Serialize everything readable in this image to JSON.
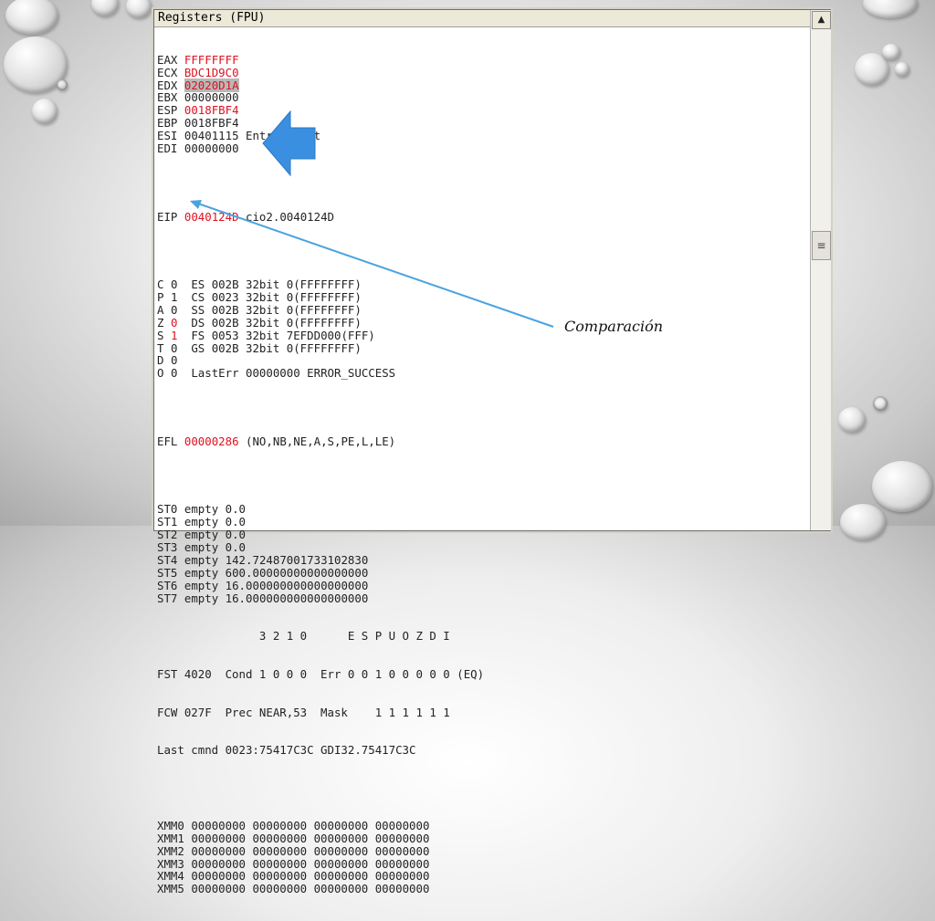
{
  "window": {
    "title": "Registers (FPU)"
  },
  "registers": [
    {
      "name": "EAX",
      "value": "FFFFFFFF",
      "style": "red",
      "comment": ""
    },
    {
      "name": "ECX",
      "value": "BDC1D9C0",
      "style": "red",
      "comment": ""
    },
    {
      "name": "EDX",
      "value": "02020D1A",
      "style": "hl",
      "comment": ""
    },
    {
      "name": "EBX",
      "value": "00000000",
      "style": "",
      "comment": ""
    },
    {
      "name": "ESP",
      "value": "0018FBF4",
      "style": "red",
      "comment": ""
    },
    {
      "name": "EBP",
      "value": "0018FBF4",
      "style": "",
      "comment": ""
    },
    {
      "name": "ESI",
      "value": "00401115",
      "style": "",
      "comment": "Entry point"
    },
    {
      "name": "EDI",
      "value": "00000000",
      "style": "",
      "comment": ""
    }
  ],
  "eip": {
    "name": "EIP",
    "value": "0040124D",
    "comment": "cio2.0040124D"
  },
  "flags": [
    {
      "name": "C",
      "value": "0",
      "red": false,
      "seg": "ES 002B 32bit 0(FFFFFFFF)"
    },
    {
      "name": "P",
      "value": "1",
      "red": false,
      "seg": "CS 0023 32bit 0(FFFFFFFF)"
    },
    {
      "name": "A",
      "value": "0",
      "red": false,
      "seg": "SS 002B 32bit 0(FFFFFFFF)"
    },
    {
      "name": "Z",
      "value": "0",
      "red": true,
      "seg": "DS 002B 32bit 0(FFFFFFFF)"
    },
    {
      "name": "S",
      "value": "1",
      "red": true,
      "seg": "FS 0053 32bit 7EFDD000(FFF)"
    },
    {
      "name": "T",
      "value": "0",
      "red": false,
      "seg": "GS 002B 32bit 0(FFFFFFFF)"
    },
    {
      "name": "D",
      "value": "0",
      "red": false,
      "seg": ""
    },
    {
      "name": "O",
      "value": "0",
      "red": false,
      "seg": "LastErr 00000000 ERROR_SUCCESS"
    }
  ],
  "efl": {
    "name": "EFL",
    "value": "00000286",
    "comment": "(NO,NB,NE,A,S,PE,L,LE)"
  },
  "fpu_stack": [
    {
      "name": "ST0",
      "status": "empty",
      "value": "0.0"
    },
    {
      "name": "ST1",
      "status": "empty",
      "value": "0.0"
    },
    {
      "name": "ST2",
      "status": "empty",
      "value": "0.0"
    },
    {
      "name": "ST3",
      "status": "empty",
      "value": "0.0"
    },
    {
      "name": "ST4",
      "status": "empty",
      "value": "142.72487001733102830"
    },
    {
      "name": "ST5",
      "status": "empty",
      "value": "600.00000000000000000"
    },
    {
      "name": "ST6",
      "status": "empty",
      "value": "16.000000000000000000"
    },
    {
      "name": "ST7",
      "status": "empty",
      "value": "16.000000000000000000"
    }
  ],
  "fpu_bits_header": "               3 2 1 0      E S P U O Z D I",
  "fst": "FST 4020  Cond 1 0 0 0  Err 0 0 1 0 0 0 0 0 (EQ)",
  "fcw": "FCW 027F  Prec NEAR,53  Mask    1 1 1 1 1 1",
  "last_cmnd": "Last cmnd 0023:75417C3C GDI32.75417C3C",
  "xmm": [
    {
      "name": "XMM0",
      "value": "00000000 00000000 00000000 00000000"
    },
    {
      "name": "XMM1",
      "value": "00000000 00000000 00000000 00000000"
    },
    {
      "name": "XMM2",
      "value": "00000000 00000000 00000000 00000000"
    },
    {
      "name": "XMM3",
      "value": "00000000 00000000 00000000 00000000"
    },
    {
      "name": "XMM4",
      "value": "00000000 00000000 00000000 00000000"
    },
    {
      "name": "XMM5",
      "value": "00000000 00000000 00000000 00000000"
    }
  ],
  "annotation": {
    "label": "Comparación"
  },
  "colors": {
    "accent_red": "#e0101e",
    "arrow_blue": "#3a8fe0",
    "pointer_line": "#4aa3e0"
  }
}
